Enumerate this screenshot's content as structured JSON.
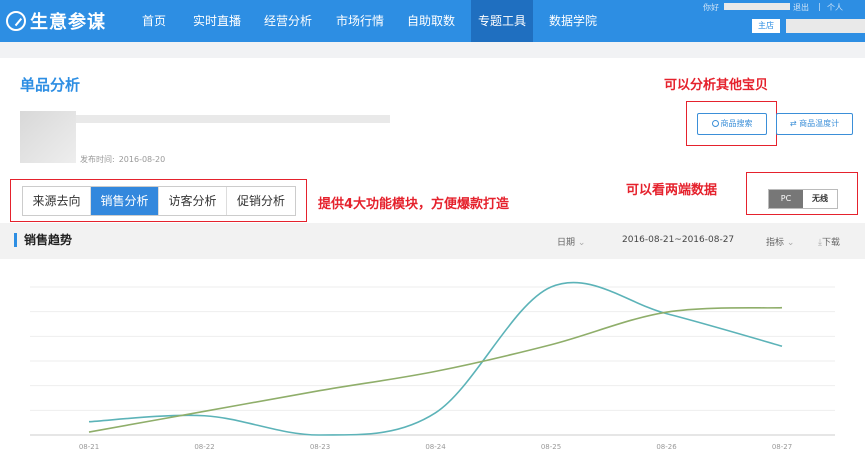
{
  "app": {
    "title": "生意参谋"
  },
  "nav": {
    "items": [
      {
        "label": "首页",
        "active": false
      },
      {
        "label": "实时直播",
        "active": false
      },
      {
        "label": "经营分析",
        "active": false
      },
      {
        "label": "市场行情",
        "active": false
      },
      {
        "label": "自助取数",
        "active": false
      },
      {
        "label": "专题工具",
        "active": true
      },
      {
        "label": "数据学院",
        "active": false
      }
    ],
    "greeting": "你好",
    "logout": "退出",
    "separator": "|",
    "personal": "个人",
    "shop_button": "主店"
  },
  "page": {
    "title": "单品分析",
    "publish_label": "发布时间:",
    "publish_date": "2016-08-20"
  },
  "actions": {
    "search_button": "商品搜索",
    "compare_button": "商品温度计"
  },
  "annotations": {
    "analyze_other": "可以分析其他宝贝",
    "two_platforms": "可以看两端数据",
    "four_modules": "提供4大功能模块，方便爆款打造"
  },
  "tabs": [
    {
      "label": "来源去向",
      "active": false
    },
    {
      "label": "销售分析",
      "active": true
    },
    {
      "label": "访客分析",
      "active": false
    },
    {
      "label": "促销分析",
      "active": false
    }
  ],
  "platform_toggle": {
    "pc": "PC",
    "mobile": "无线",
    "selected": "PC"
  },
  "trend": {
    "title": "销售趋势",
    "date_label": "日期",
    "date_range": "2016-08-21~2016-08-27",
    "metric_label": "指标",
    "download_label": "下载"
  },
  "chart_data": {
    "type": "line",
    "x": [
      "08-21",
      "08-22",
      "08-23",
      "08-24",
      "08-25",
      "08-26",
      "08-27"
    ],
    "series": [
      {
        "color": "#5cb3b8",
        "values": [
          0.09,
          0.13,
          0.0,
          0.15,
          1.0,
          0.82,
          0.6
        ]
      },
      {
        "color": "#8fae6a",
        "values": [
          0.02,
          0.16,
          0.3,
          0.43,
          0.61,
          0.83,
          0.86
        ]
      }
    ],
    "ylim": [
      0,
      1
    ],
    "grid": true,
    "legend": "none"
  },
  "colors": {
    "brand": "#2d8ee3",
    "annotation": "#e5222d",
    "active_tab": "#3388dd"
  }
}
